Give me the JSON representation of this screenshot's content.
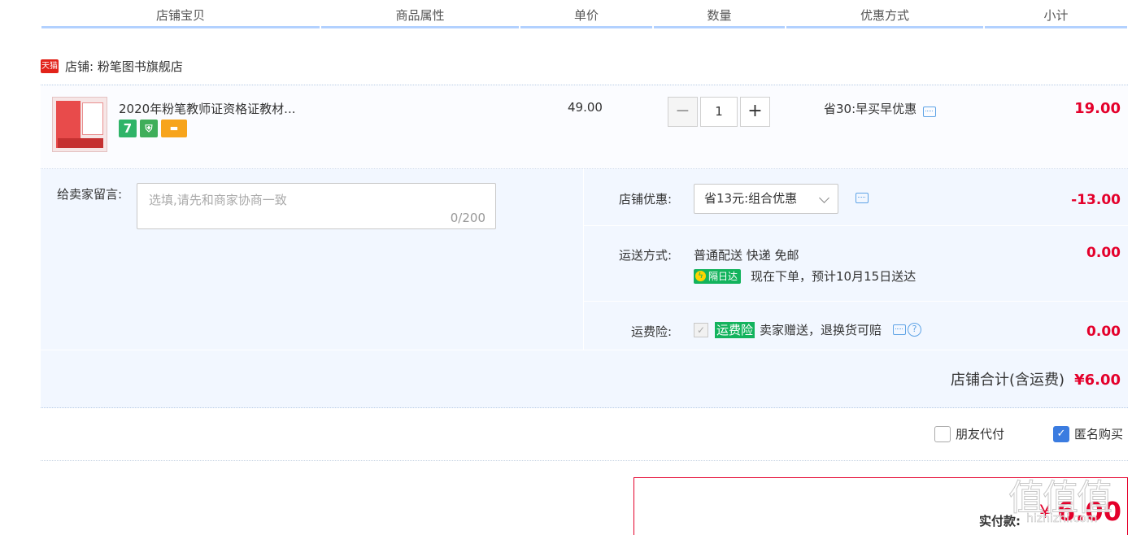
{
  "header": {
    "columns": [
      "店铺宝贝",
      "商品属性",
      "单价",
      "数量",
      "优惠方式",
      "小计"
    ]
  },
  "shop": {
    "badge": "天猫",
    "label": "店铺: 粉笔图书旗舰店"
  },
  "item": {
    "title": "2020年粉笔教师证资格证教材...",
    "service_icons": [
      "7",
      "⛨",
      "▬"
    ],
    "unit_price": "49.00",
    "quantity": "1",
    "minus": "−",
    "plus": "+",
    "promotion": "省30:早买早优惠",
    "subtotal": "19.00"
  },
  "message": {
    "label": "给卖家留言:",
    "placeholder": "选填,请先和商家协商一致",
    "counter": "0/200"
  },
  "shop_discount": {
    "label": "店铺优惠:",
    "selected": "省13元:组合优惠",
    "amount": "-13.00"
  },
  "shipping": {
    "label": "运送方式:",
    "method": "普通配送 快递 免邮",
    "badge": "隔日达",
    "eta": "现在下单，预计10月15日送达",
    "amount": "0.00"
  },
  "insurance": {
    "label": "运费险:",
    "check_mark": "✓",
    "badge": "运费险",
    "description": "卖家赠送，退换货可赔",
    "help": "?",
    "amount": "0.00"
  },
  "shop_total": {
    "label": "店铺合计(含运费)",
    "amount": "¥6.00"
  },
  "options": {
    "friend_pay": "朋友代付",
    "anonymous": "匿名购买",
    "anonymous_check": "✓"
  },
  "payment": {
    "label": "实付款:",
    "currency": "¥",
    "amount": "6.00"
  },
  "watermark": {
    "text": "值值值",
    "sub": "hizhizhi.com"
  },
  "colors": {
    "price_red": "#e4002b",
    "header_blue": "#b2d1ff",
    "panel_bg": "#f2f7ff",
    "green_badge": "#13b35d",
    "check_blue": "#3b7ce0"
  }
}
